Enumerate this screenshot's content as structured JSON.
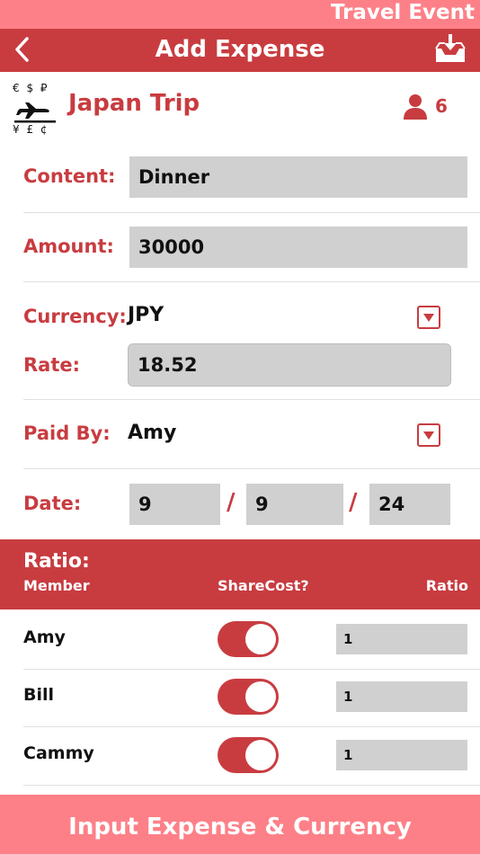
{
  "header": {
    "banner": "Travel Event",
    "title": "Add Expense"
  },
  "trip": {
    "logo_top": "€ $ ₽",
    "logo_bottom": "¥ £ ¢",
    "name": "Japan Trip",
    "members_count": "6"
  },
  "form": {
    "content_label": "Content:",
    "content_value": "Dinner",
    "amount_label": "Amount:",
    "amount_value": "30000",
    "currency_label": "Currency:",
    "currency_value": "JPY",
    "rate_label": "Rate:",
    "rate_value": "18.52",
    "paidby_label": "Paid By:",
    "paidby_value": "Amy",
    "date_label": "Date:",
    "date_month": "9",
    "date_day": "9",
    "date_year": "24",
    "date_sep": "/"
  },
  "ratio": {
    "title": "Ratio:",
    "col_member": "Member",
    "col_share": "ShareCost?",
    "col_ratio": "Ratio",
    "members": [
      {
        "name": "Amy",
        "share": true,
        "ratio": "1"
      },
      {
        "name": "Bill",
        "share": true,
        "ratio": "1"
      },
      {
        "name": "Cammy",
        "share": true,
        "ratio": "1"
      }
    ]
  },
  "footer": {
    "button_label": "Input Expense & Currency"
  },
  "colors": {
    "accent": "#c83c40",
    "banner": "#fd8088",
    "field": "#d0d0d0"
  },
  "icons": {
    "back": "chevron-left-icon",
    "inbox": "inbox-download-icon",
    "person": "person-icon",
    "dropdown": "dropdown-caret-icon",
    "plane": "airplane-icon"
  }
}
